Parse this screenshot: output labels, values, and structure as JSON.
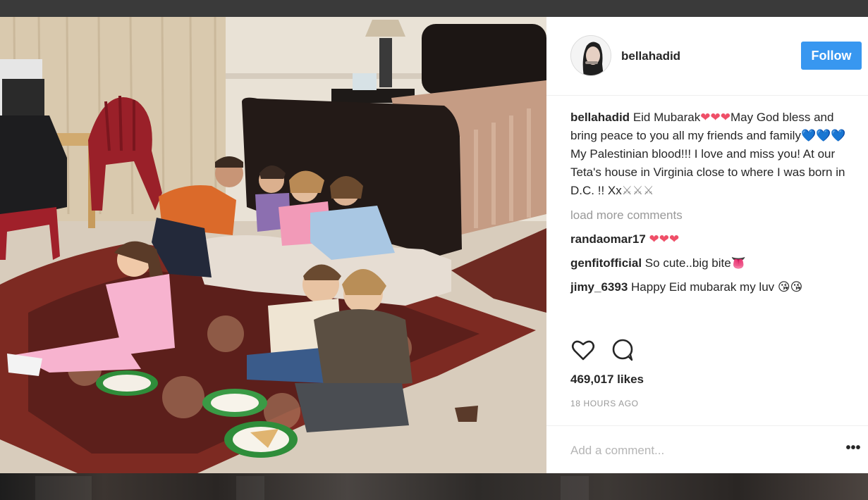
{
  "post": {
    "username": "bellahadid",
    "follow_label": "Follow",
    "caption": {
      "username": "bellahadid",
      "part1": "Eid Mubarak",
      "hearts1": "❤❤❤",
      "part2": "May God bless and bring peace to you all my friends and family",
      "hearts2": "💙💙💙",
      "part3": "My Palestinian blood!!! I love and miss you! At our Teta's house in Virginia close to where I was born in D.C. !! Xx",
      "swords": "⚔⚔⚔"
    },
    "load_more": "load more comments",
    "comments": [
      {
        "username": "randaomar17",
        "text": "",
        "emoji": "❤❤❤"
      },
      {
        "username": "genfitofficial",
        "text": "So cute..big bite",
        "emoji": "👅"
      },
      {
        "username": "jimy_6393",
        "text": "Happy Eid mubarak my luv",
        "emoji": "😘😘"
      }
    ],
    "likes": "469,017 likes",
    "time_ago": "18 HOURS AGO",
    "add_comment_placeholder": "Add a comment...",
    "more_label": "•••",
    "icons": {
      "like": "heart-outline-icon",
      "comment": "speech-bubble-icon",
      "more": "ellipsis-icon"
    }
  }
}
